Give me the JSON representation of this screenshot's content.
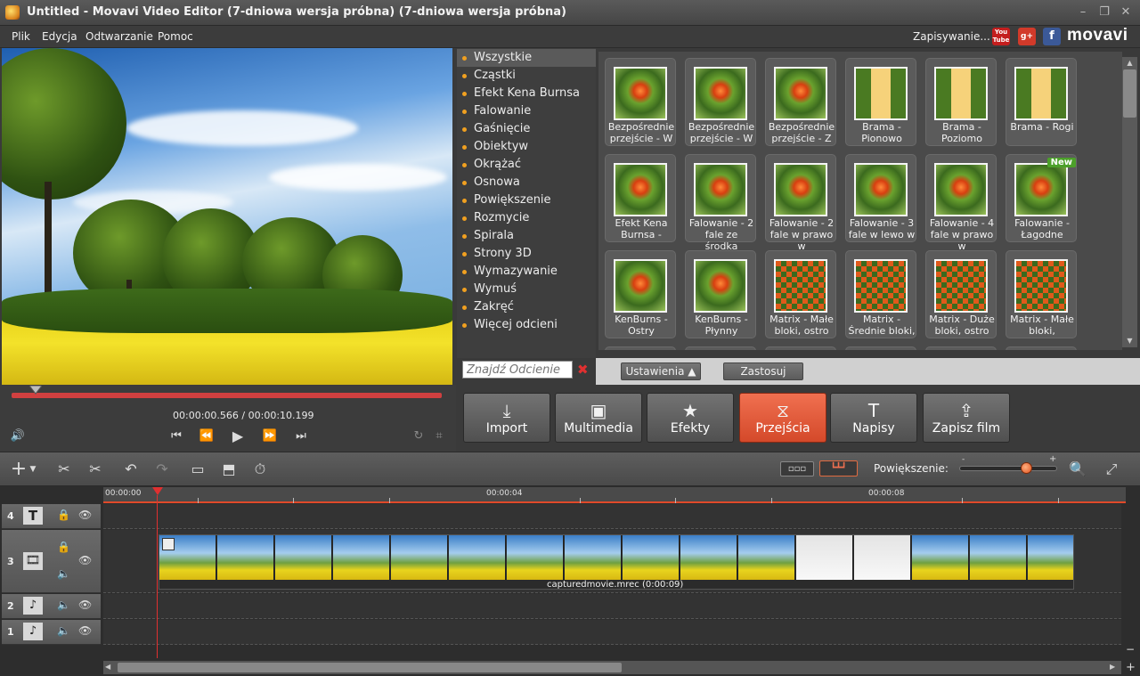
{
  "window": {
    "title": "Untitled - Movavi Video Editor (7-dniowa wersja próbna) (7-dniowa wersja próbna)",
    "controls": {
      "minimize": "–",
      "restore": "❐",
      "close": "✕"
    }
  },
  "menu": {
    "items": [
      "Plik",
      "Edycja",
      "Odtwarzanie",
      "Pomoc"
    ],
    "saving_label": "Zapisywanie...",
    "social": {
      "youtube": "You\nTube",
      "gplus": "g+",
      "facebook": "f"
    },
    "logo": "movavi"
  },
  "categories": {
    "items": [
      "Wszystkie",
      "Cząstki",
      "Efekt Kena Burnsa",
      "Falowanie",
      "Gaśnięcie",
      "Obiektyw",
      "Okrążać",
      "Osnowa",
      "Powiększenie",
      "Rozmycie",
      "Spirala",
      "Strony 3D",
      "Wymazywanie",
      "Wymuś",
      "Zakręć",
      "Więcej odcieni"
    ],
    "active_index": 0,
    "search_placeholder": "Znajdź Odcienie"
  },
  "transitions": [
    {
      "label": "Bezpośrednie przejście - W"
    },
    {
      "label": "Bezpośrednie przejście - W"
    },
    {
      "label": "Bezpośrednie przejście - Z"
    },
    {
      "label": "Brama - Pionowo"
    },
    {
      "label": "Brama - Poziomo"
    },
    {
      "label": "Brama - Rogi"
    },
    {
      "label": "Efekt Kena Burnsa -"
    },
    {
      "label": "Falowanie - 2 fale ze środka"
    },
    {
      "label": "Falowanie - 2 fale w prawo w"
    },
    {
      "label": "Falowanie - 3 fale w lewo w"
    },
    {
      "label": "Falowanie - 4 fale w prawo w"
    },
    {
      "label": "Falowanie - Łagodne",
      "badge": "New"
    },
    {
      "label": "KenBurns - Ostry"
    },
    {
      "label": "KenBurns - Płynny"
    },
    {
      "label": "Matrix - Małe bloki, ostro"
    },
    {
      "label": "Matrix - Średnie bloki,"
    },
    {
      "label": "Matrix - Duże bloki, ostro"
    },
    {
      "label": "Matrix - Małe bloki,"
    }
  ],
  "grid_bottom": {
    "settings_label": "Ustawienia",
    "apply_label": "Zastosuj"
  },
  "player": {
    "current_time": "00:00:00.566",
    "total_time": "00:00:10.199",
    "separator": "/",
    "progress": 0.055
  },
  "actions": [
    {
      "id": "import",
      "label": "Import",
      "icon": "⤓"
    },
    {
      "id": "multimedia",
      "label": "Multimedia",
      "icon": "▣"
    },
    {
      "id": "efekty",
      "label": "Efekty",
      "icon": "★"
    },
    {
      "id": "przejscia",
      "label": "Przejścia",
      "icon": "⧖",
      "active": true
    },
    {
      "id": "napisy",
      "label": "Napisy",
      "icon": "T"
    },
    {
      "id": "zapisz",
      "label": "Zapisz film",
      "icon": "⇪"
    }
  ],
  "toolbar": {
    "zoom_label": "Powiększenie:",
    "zoom_minus": "-",
    "zoom_plus": "+",
    "zoom_level": 0.7
  },
  "timeline": {
    "ruler": [
      "00:00:00",
      "00:00:04",
      "00:00:08"
    ],
    "tracks": [
      "4",
      "3",
      "2",
      "1"
    ],
    "clip_label": "capturedmovie.mrec (0:00:09)"
  },
  "colors": {
    "accent": "#e0502a",
    "bullet": "#f0a020",
    "new_badge": "#4ca02a"
  }
}
